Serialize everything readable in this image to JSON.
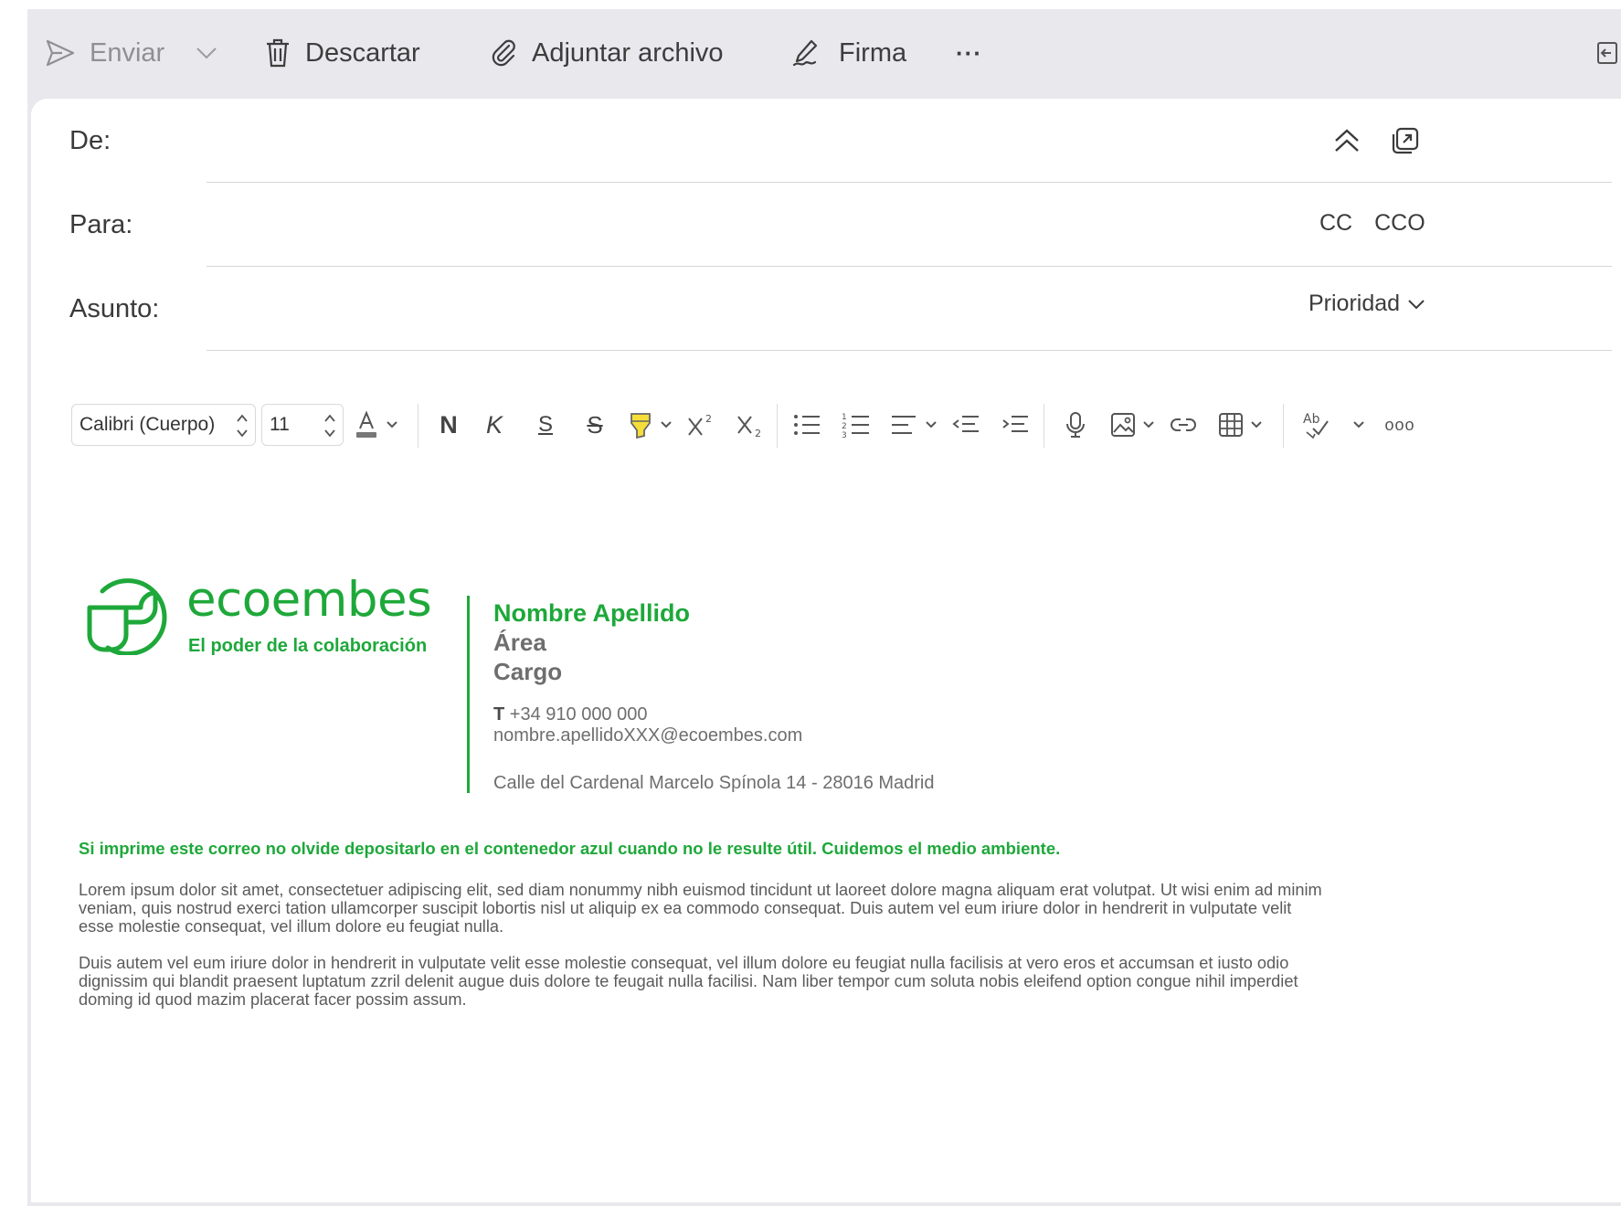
{
  "toolbar": {
    "send_label": "Enviar",
    "discard_label": "Descartar",
    "attach_label": "Adjuntar archivo",
    "signature_label": "Firma",
    "more_label": "···"
  },
  "header": {
    "from_label": "De:",
    "to_label": "Para:",
    "cc_label": "CC",
    "bcc_label": "CCO",
    "subject_label": "Asunto:",
    "priority_label": "Prioridad"
  },
  "format": {
    "font_family": "Calibri (Cuerpo)",
    "font_size": "11",
    "bold_glyph": "N",
    "italic_glyph": "K",
    "underline_glyph": "S",
    "strike_glyph": "S",
    "overflow_glyph": "ooo"
  },
  "signature": {
    "brand": "ecoembes",
    "tagline": "El poder de la colaboración",
    "name": "Nombre Apellido",
    "area": "Área",
    "role": "Cargo",
    "phone_prefix": "T",
    "phone": "+34 910 000 000",
    "email": "nombre.apellidoXXX@ecoembes.com",
    "address": "Calle del Cardenal Marcelo Spínola 14 - 28016 Madrid",
    "brand_color": "#1ea83a"
  },
  "body": {
    "eco_note": "Si imprime este correo no olvide depositarlo en el contenedor azul cuando no le resulte útil. Cuidemos el medio ambiente.",
    "lorem1_line1": "Lorem ipsum dolor sit amet, consectetuer adipiscing elit, sed diam nonummy nibh euismod tincidunt ut laoreet dolore magna aliquam erat volutpat.  Ut wisi enim ad minim",
    "lorem1_line2": "veniam, quis nostrud exerci tation ullamcorper suscipit lobortis nisl ut aliquip ex ea commodo consequat.  Duis autem vel eum iriure dolor in hendrerit in vulputate velit",
    "lorem1_line3": "esse molestie consequat, vel illum dolore eu feugiat nulla.",
    "lorem2_line1": "Duis autem vel eum iriure dolor in hendrerit in vulputate velit esse molestie consequat, vel illum dolore eu feugiat nulla facilisis at vero eros et accumsan et iusto odio",
    "lorem2_line2": "dignissim qui blandit praesent luptatum zzril delenit augue duis dolore te feugait nulla facilisi. Nam liber tempor cum soluta nobis eleifend option congue nihil imperdiet",
    "lorem2_line3": "doming id quod mazim placerat facer possim assum."
  },
  "icons": {
    "send": "send-icon",
    "discard": "trash-icon",
    "attach": "paperclip-icon",
    "signature": "pen-signature-icon",
    "collapse": "collapse-pane-icon",
    "expand_up": "double-chevron-up-icon",
    "popout": "popout-icon"
  }
}
